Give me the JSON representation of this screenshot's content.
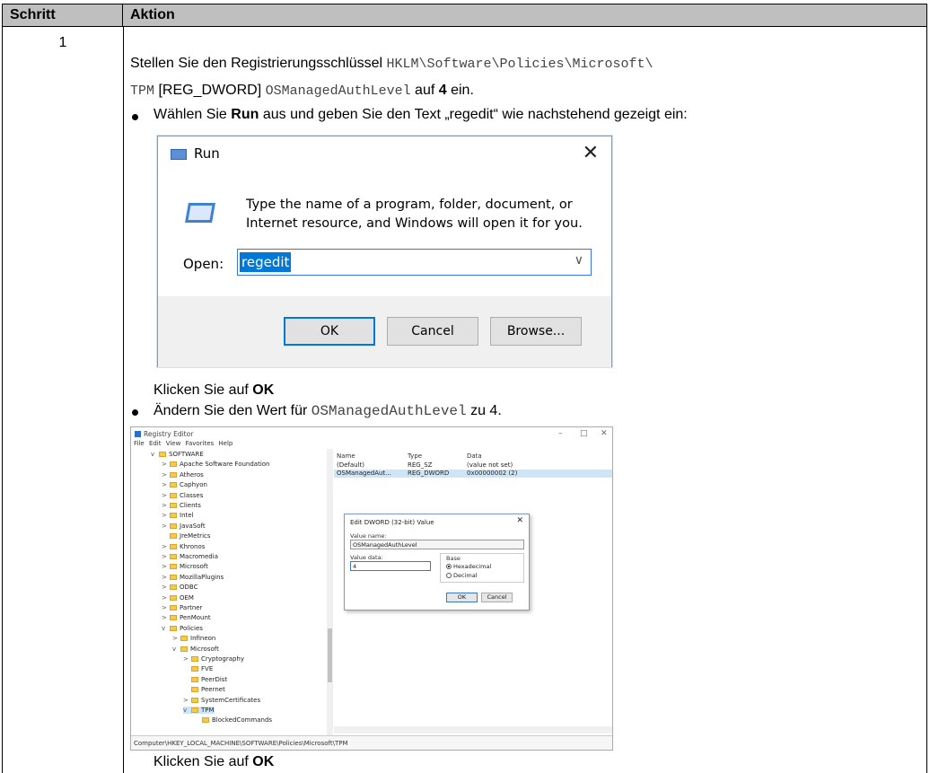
{
  "table": {
    "col_step": "Schritt",
    "col_action": "Aktion",
    "step_number": "1",
    "line1_pre": "Stellen Sie den Registrierungsschlüssel ",
    "line1_code": "HKLM\\Software\\Policies\\Microsoft\\",
    "line2_code1": "TPM",
    "line2_text1": " [REG_DWORD] ",
    "line2_code2": "OSManagedAuthLevel",
    "line2_text2": " auf ",
    "line2_bold": "4",
    "line2_text3": " ein.",
    "bullet1_pre": "Wählen Sie ",
    "bullet1_bold": "Run",
    "bullet1_post": " aus und geben Sie den Text „regedit“ wie nachstehend gezeigt ein:",
    "click_ok1_pre": "Klicken Sie auf ",
    "click_ok1_bold": "OK",
    "bullet2_pre": "Ändern Sie den Wert für ",
    "bullet2_code": "OSManagedAuthLevel",
    "bullet2_post": " zu 4.",
    "click_ok2_pre": "Klicken Sie auf ",
    "click_ok2_bold": "OK"
  },
  "run_dialog": {
    "title": "Run",
    "description": "Type the name of a program, folder, document, or Internet resource, and Windows will open it for you.",
    "open_label": "Open:",
    "open_value": "regedit",
    "ok": "OK",
    "cancel": "Cancel",
    "browse": "Browse..."
  },
  "registry_editor": {
    "title": "Registry Editor",
    "menu": "File  Edit  View  Favorites  Help",
    "tree": [
      {
        "label": "SOFTWARE",
        "arrow": "v"
      },
      {
        "label": "Apache Software Foundation",
        "arrow": ">"
      },
      {
        "label": "Atheros",
        "arrow": ">"
      },
      {
        "label": "Caphyon",
        "arrow": ">"
      },
      {
        "label": "Classes",
        "arrow": ">"
      },
      {
        "label": "Clients",
        "arrow": ">"
      },
      {
        "label": "Intel",
        "arrow": ">"
      },
      {
        "label": "JavaSoft",
        "arrow": ">"
      },
      {
        "label": "JreMetrics",
        "arrow": ""
      },
      {
        "label": "Khronos",
        "arrow": ">"
      },
      {
        "label": "Macromedia",
        "arrow": ">"
      },
      {
        "label": "Microsoft",
        "arrow": ">"
      },
      {
        "label": "MozillaPlugins",
        "arrow": ">"
      },
      {
        "label": "ODBC",
        "arrow": ">"
      },
      {
        "label": "OEM",
        "arrow": ">"
      },
      {
        "label": "Partner",
        "arrow": ">"
      },
      {
        "label": "PenMount",
        "arrow": ">"
      },
      {
        "label": "Policies",
        "arrow": "v"
      },
      {
        "label": "Infineon",
        "arrow": ">"
      },
      {
        "label": "Microsoft",
        "arrow": "v"
      },
      {
        "label": "Cryptography",
        "arrow": ">"
      },
      {
        "label": "FVE",
        "arrow": ""
      },
      {
        "label": "PeerDist",
        "arrow": ""
      },
      {
        "label": "Peernet",
        "arrow": ""
      },
      {
        "label": "SystemCertificates",
        "arrow": ">"
      },
      {
        "label": "TPM",
        "arrow": "v"
      },
      {
        "label": "BlockedCommands",
        "arrow": ""
      }
    ],
    "columns": {
      "name": "Name",
      "type": "Type",
      "data": "Data"
    },
    "rows": [
      {
        "name": "(Default)",
        "type": "REG_SZ",
        "data": "(value not set)"
      },
      {
        "name": "OSManagedAut...",
        "type": "REG_DWORD",
        "data": "0x00000002 (2)"
      }
    ],
    "status": "Computer\\HKEY_LOCAL_MACHINE\\SOFTWARE\\Policies\\Microsoft\\TPM",
    "dword_dialog": {
      "title": "Edit DWORD (32-bit) Value",
      "value_name_label": "Value name:",
      "value_name": "OSManagedAuthLevel",
      "value_data_label": "Value data:",
      "value_data": "4",
      "base_label": "Base",
      "hex": "Hexadecimal",
      "dec": "Decimal",
      "ok": "OK",
      "cancel": "Cancel"
    }
  }
}
